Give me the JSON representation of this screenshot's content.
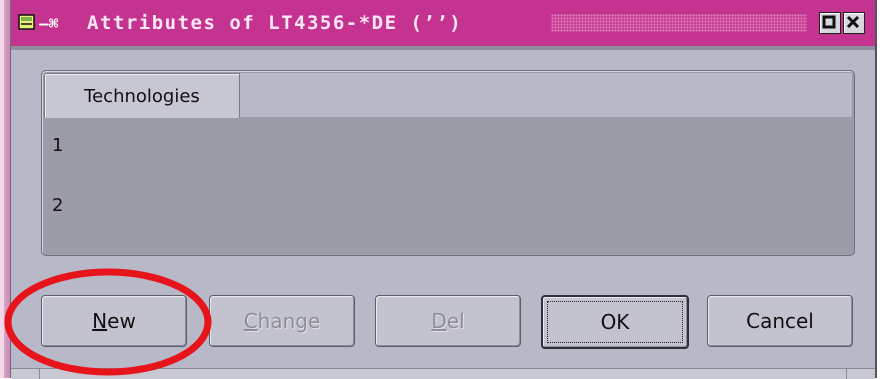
{
  "window": {
    "title": "Attributes of LT4356-*DE (’’)",
    "title_icon": "book-icon",
    "title_separator_icon": "window-menu-icon",
    "maximize_icon": "maximize-icon",
    "close_icon": "close-icon",
    "titlebar_color": "#c3338f"
  },
  "tab": {
    "label": "Technologies"
  },
  "list": {
    "items": [
      "1",
      "2"
    ]
  },
  "buttons": {
    "new": {
      "label_underlined": "N",
      "label_rest": "ew",
      "enabled": true
    },
    "change": {
      "label_underlined": "C",
      "label_rest": "hange",
      "enabled": false
    },
    "del": {
      "label_underlined": "D",
      "label_rest": "el",
      "enabled": false
    },
    "ok": {
      "label": "OK",
      "enabled": true,
      "default": true
    },
    "cancel": {
      "label": "Cancel",
      "enabled": true
    }
  },
  "annotation": {
    "shape": "ellipse",
    "color": "#e8141c",
    "highlights": "new-button"
  }
}
